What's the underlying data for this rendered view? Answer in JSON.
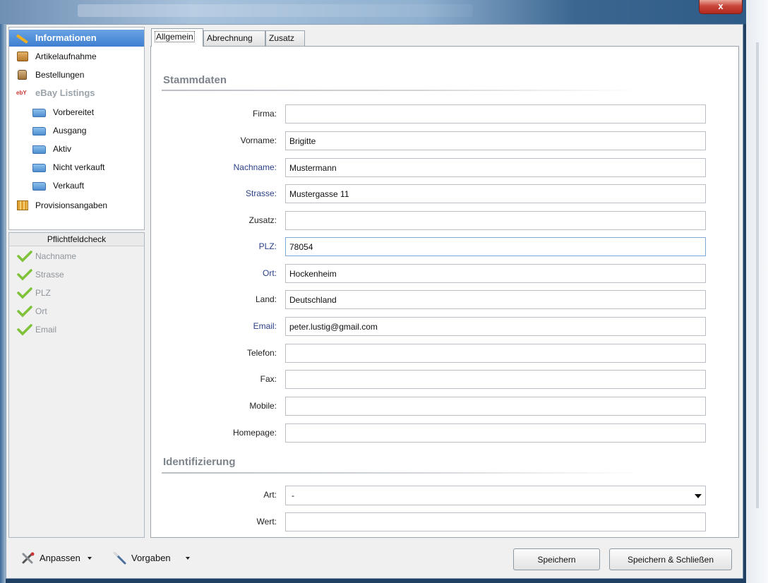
{
  "window": {
    "close_glyph": "x"
  },
  "sidebar": {
    "items": [
      {
        "label": "Informationen",
        "icon": "pencil-icon",
        "state": "selected"
      },
      {
        "label": "Artikelaufnahme",
        "icon": "package-icon"
      },
      {
        "label": "Bestellungen",
        "icon": "shopping-bag-icon"
      },
      {
        "label": "eBay Listings",
        "icon": "ebay-icon",
        "state": "disabled",
        "icon_text": "ebY"
      },
      {
        "label": "Vorbereitet",
        "icon": "folder-icon"
      },
      {
        "label": "Ausgang",
        "icon": "folder-icon"
      },
      {
        "label": "Aktiv",
        "icon": "folder-icon"
      },
      {
        "label": "Nicht verkauft",
        "icon": "folder-icon"
      },
      {
        "label": "Verkauft",
        "icon": "folder-icon"
      },
      {
        "label": "Provisionsangaben",
        "icon": "columns-icon"
      }
    ]
  },
  "check": {
    "title": "Pflichtfeldcheck",
    "items": [
      "Nachname",
      "Strasse",
      "PLZ",
      "Ort",
      "Email"
    ]
  },
  "tabs": [
    {
      "label": "Allgemein",
      "active": true
    },
    {
      "label": "Abrechnung"
    },
    {
      "label": "Zusatz"
    }
  ],
  "sections": {
    "stammdaten": "Stammdaten",
    "identifizierung": "Identifizierung"
  },
  "fields": [
    {
      "label": "Firma:",
      "value": ""
    },
    {
      "label": "Vorname:",
      "value": "Brigitte"
    },
    {
      "label": "Nachname:",
      "value": "Mustermann",
      "required": true
    },
    {
      "label": "Strasse:",
      "value": "Mustergasse 11",
      "required": true
    },
    {
      "label": "Zusatz:",
      "value": ""
    },
    {
      "label": "PLZ:",
      "value": "78054",
      "required": true
    },
    {
      "label": "Ort:",
      "value": "Hockenheim",
      "required": true
    },
    {
      "label": "Land:",
      "value": "Deutschland"
    },
    {
      "label": "Email:",
      "value": "peter.lustig@gmail.com",
      "required": true
    },
    {
      "label": "Telefon:",
      "value": ""
    },
    {
      "label": "Fax:",
      "value": ""
    },
    {
      "label": "Mobile:",
      "value": ""
    },
    {
      "label": "Homepage:",
      "value": ""
    }
  ],
  "ident": {
    "art_label": "Art:",
    "art_value": "-",
    "wert_label": "Wert:",
    "wert_value": ""
  },
  "toolbar": {
    "anpassen": "Anpassen",
    "vorgaben": "Vorgaben",
    "speichern": "Speichern",
    "speichern_schliessen": "Speichern & Schließen"
  },
  "colors": {
    "selection": "#3d7fd0",
    "required_label": "#2a3f88",
    "check_green": "#7ec23a"
  }
}
